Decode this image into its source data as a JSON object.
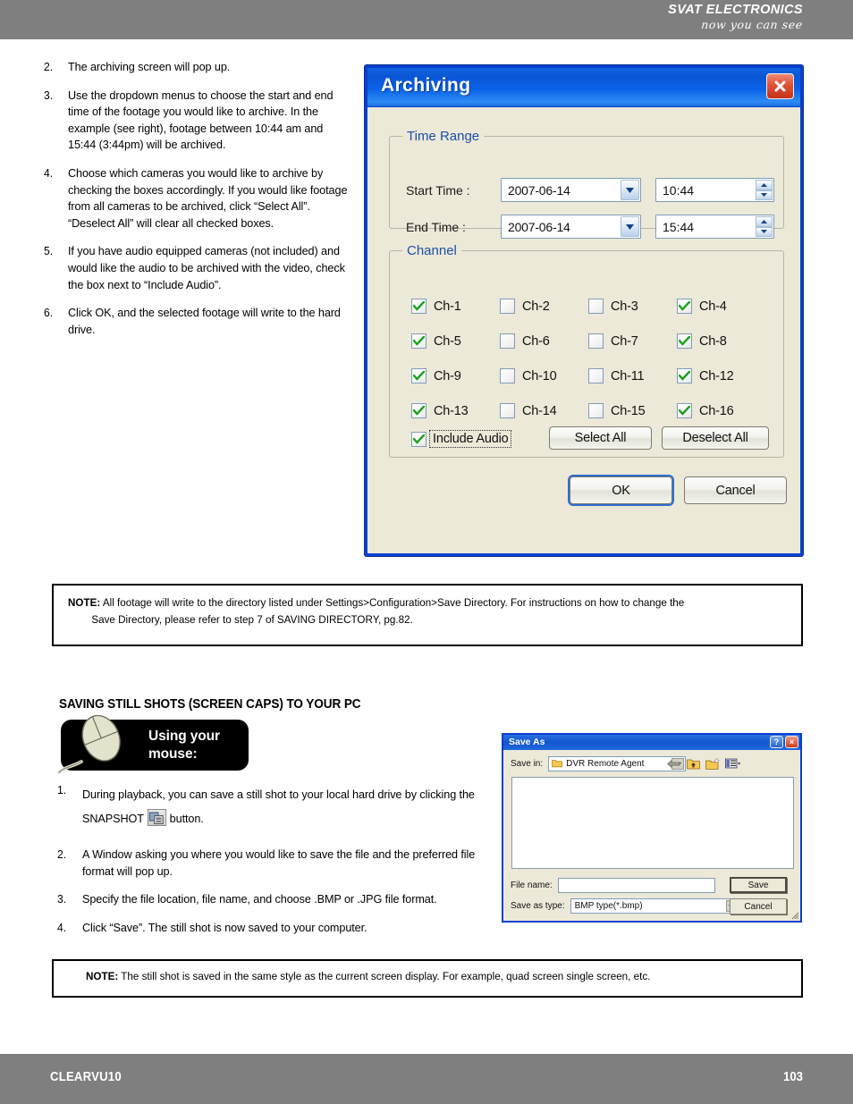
{
  "header": {
    "brand_name": "SVAT ELECTRONICS",
    "tagline": "now you can see"
  },
  "footer": {
    "product": "CLEARVU10",
    "page_number": "103"
  },
  "steps_top": [
    {
      "num": "2.",
      "text": "The archiving screen will pop up."
    },
    {
      "num": "3.",
      "text": "Use the dropdown menus to choose the start and end time of the footage you would like to archive.  In the example (see right), footage between 10:44 am and 15:44 (3:44pm) will be archived."
    },
    {
      "num": "4.",
      "text": "Choose which cameras you would like to archive by checking the boxes accordingly.  If you would like footage from all cameras to be archived, click “Select All”.  “Deselect All” will clear all checked boxes."
    },
    {
      "num": "5.",
      "text": "If you have audio equipped cameras (not included) and would like the audio to be archived with the video, check the box next to “Include Audio”."
    },
    {
      "num": "6.",
      "text": "Click OK, and the selected footage will write to the hard drive."
    }
  ],
  "archiving_dialog": {
    "title": "Archiving",
    "close_icon": "close-icon",
    "time_range": {
      "legend": "Time Range",
      "start_label": "Start Time :",
      "start_date": "2007-06-14",
      "start_time": "10:44",
      "end_label": "End Time :",
      "end_date": "2007-06-14",
      "end_time": "15:44"
    },
    "channel": {
      "legend": "Channel",
      "items": [
        {
          "label": "Ch-1",
          "checked": true
        },
        {
          "label": "Ch-2",
          "checked": false
        },
        {
          "label": "Ch-3",
          "checked": false
        },
        {
          "label": "Ch-4",
          "checked": true
        },
        {
          "label": "Ch-5",
          "checked": true
        },
        {
          "label": "Ch-6",
          "checked": false
        },
        {
          "label": "Ch-7",
          "checked": false
        },
        {
          "label": "Ch-8",
          "checked": true
        },
        {
          "label": "Ch-9",
          "checked": true
        },
        {
          "label": "Ch-10",
          "checked": false
        },
        {
          "label": "Ch-11",
          "checked": false
        },
        {
          "label": "Ch-12",
          "checked": true
        },
        {
          "label": "Ch-13",
          "checked": true
        },
        {
          "label": "Ch-14",
          "checked": false
        },
        {
          "label": "Ch-15",
          "checked": false
        },
        {
          "label": "Ch-16",
          "checked": true
        }
      ],
      "include_audio_label": "Include Audio",
      "include_audio_checked": true,
      "select_all_label": "Select All",
      "deselect_all_label": "Deselect All"
    },
    "ok_label": "OK",
    "cancel_label": "Cancel"
  },
  "note_1": {
    "label": "NOTE:",
    "line1": "All footage will write to the directory listed under Settings>Configuration>Save Directory.  For instructions on how to change the",
    "line2": "Save Directory, please refer to step 7 of SAVING DIRECTORY, pg.82."
  },
  "section": {
    "heading": "SAVING STILL SHOTS (SCREEN CAPS) TO YOUR PC",
    "badge_line1": "Using your",
    "badge_line2": "mouse:"
  },
  "steps_bottom": [
    {
      "num": "1.",
      "text_before": "During playback, you can save a still shot to your local hard drive by clicking the SNAPSHOT",
      "text_after": "button."
    },
    {
      "num": "2.",
      "text": "A Window asking you where you would like to save the file and the preferred file format will pop up."
    },
    {
      "num": "3.",
      "text": "Specify the file location, file name, and choose .BMP or .JPG file format."
    },
    {
      "num": "4.",
      "text": "Click “Save”.  The still shot is now saved to your computer."
    }
  ],
  "saveas_dialog": {
    "title": "Save As",
    "help_label": "?",
    "close_label": "×",
    "savein_label": "Save in:",
    "savein_value": "DVR Remote Agent",
    "tools": [
      "back-icon",
      "up-folder-icon",
      "new-folder-icon",
      "views-icon"
    ],
    "filename_label": "File name:",
    "filename_value": "",
    "savetype_label": "Save as type:",
    "savetype_value": "BMP type(*.bmp)",
    "save_label": "Save",
    "cancel_label": "Cancel"
  },
  "note_2": {
    "label": "NOTE:",
    "line1": "The still shot is saved in the same style as the current screen display.  For example, quad screen single screen, etc."
  },
  "colors": {
    "header_gray": "#7f7f7f",
    "dialog_blue": "#0a3fd1",
    "dialog_face": "#ece9d8",
    "legend_blue": "#1d4fa8",
    "check_green": "#19a319"
  }
}
